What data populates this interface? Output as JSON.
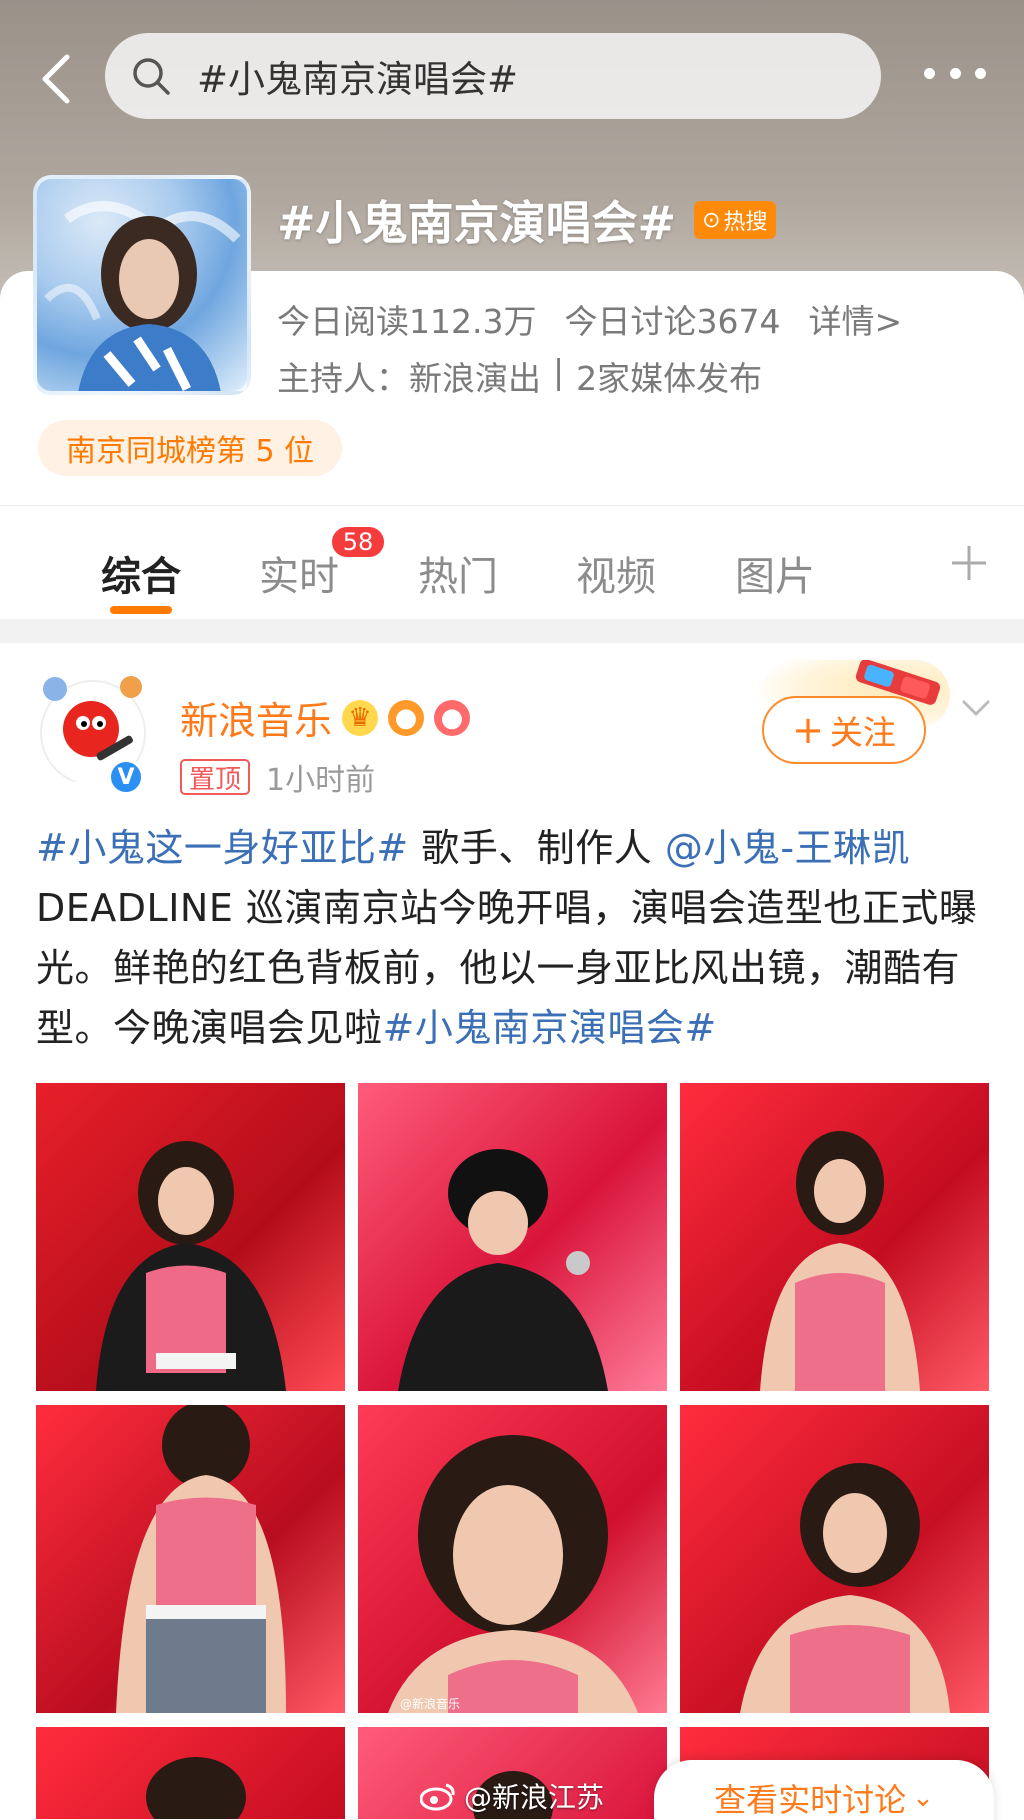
{
  "header": {
    "search_query": "#小鬼南京演唱会#",
    "topic_title": "#小鬼南京演唱会#",
    "hot_badge": "热搜",
    "stats": {
      "read_today": "今日阅读112.3万",
      "discuss_today": "今日讨论3674",
      "details": "详情>"
    },
    "host_label": "主持人：新浪演出",
    "media_count": "2家媒体发布",
    "rank_pill": "南京同城榜第 5 位"
  },
  "tabs": [
    {
      "label": "综合",
      "active": true
    },
    {
      "label": "实时",
      "badge": "58"
    },
    {
      "label": "热门"
    },
    {
      "label": "视频"
    },
    {
      "label": "图片"
    }
  ],
  "post": {
    "author": "新浪音乐",
    "pinned_label": "置顶",
    "time": "1小时前",
    "follow_label": "关注",
    "text_segments": [
      {
        "text": "#小鬼这一身好亚比#",
        "tag": true
      },
      {
        "text": " 歌手、制作人 ",
        "tag": false
      },
      {
        "text": "@小鬼-王琳凯",
        "tag": true
      },
      {
        "text": " DEADLINE 巡演南京站今晚开唱，演唱会造型也正式曝光。鲜艳的红色背板前，他以一身亚比风出镜，潮酷有型。今晚演唱会见啦",
        "tag": false
      },
      {
        "text": "#小鬼南京演唱会#",
        "tag": true
      }
    ],
    "image_watermark": "@新浪音乐"
  },
  "footer": {
    "watermark": "@新浪江苏",
    "live_discussion": "查看实时讨论"
  },
  "colors": {
    "accent_orange": "#ff7a1a",
    "link_blue": "#3b6fb6",
    "badge_red": "#f53b3b",
    "verify_blue": "#2c8ff2"
  }
}
